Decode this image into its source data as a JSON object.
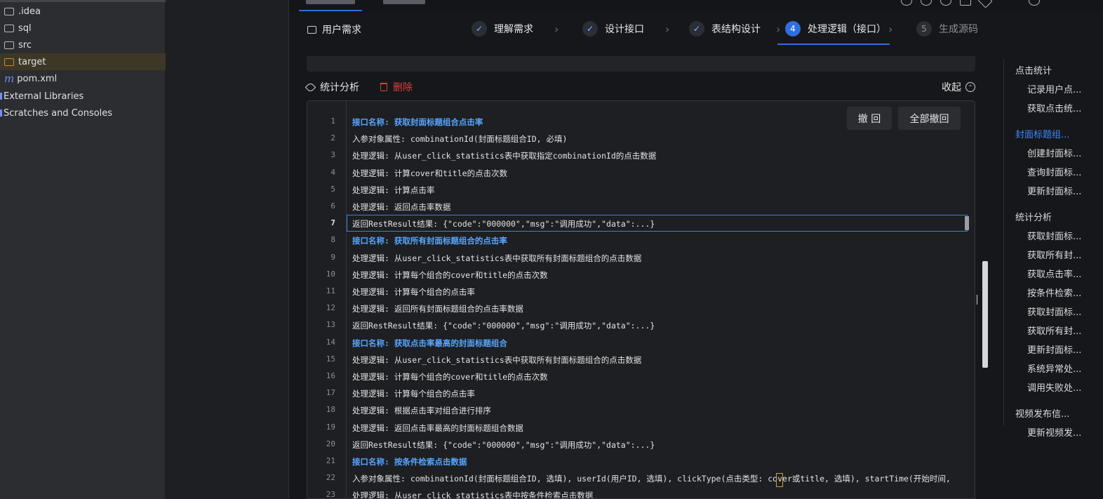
{
  "project_tree": [
    {
      "label": ".idea",
      "icon": "folder-icon"
    },
    {
      "label": "sql",
      "icon": "folder-icon"
    },
    {
      "label": "src",
      "icon": "folder-icon"
    },
    {
      "label": "target",
      "icon": "folder-orange-icon",
      "selected": true
    },
    {
      "label": "pom.xml",
      "icon": "maven-icon"
    },
    {
      "label": "External Libraries",
      "icon": "library-icon"
    },
    {
      "label": "Scratches and Consoles",
      "icon": "scratch-icon"
    }
  ],
  "header": {
    "requirement_label": "用户需求",
    "steps": [
      {
        "mark": "✓",
        "label": "理解需求",
        "state": "done"
      },
      {
        "mark": "✓",
        "label": "设计接口",
        "state": "done"
      },
      {
        "mark": "✓",
        "label": "表结构设计",
        "state": "done"
      },
      {
        "mark": "4",
        "label": "处理逻辑（接口）",
        "state": "current"
      },
      {
        "mark": "5",
        "label": "生成源码",
        "state": "todo"
      }
    ]
  },
  "section": {
    "title": "统计分析",
    "delete_label": "删除",
    "collapse_label": "收起"
  },
  "editor": {
    "undo_label": "撤 回",
    "undo_all_label": "全部撤回",
    "current_line": 7,
    "lines": [
      {
        "n": "1",
        "text": "接口名称: 获取封面标题组合点击率",
        "hl": true
      },
      {
        "n": "2",
        "text": "入参对象属性: combinationId(封面标题组合ID, 必填)"
      },
      {
        "n": "3",
        "text": "处理逻辑: 从user_click_statistics表中获取指定combinationId的点击数据"
      },
      {
        "n": "4",
        "text": "处理逻辑: 计算cover和title的点击次数"
      },
      {
        "n": "5",
        "text": "处理逻辑: 计算点击率"
      },
      {
        "n": "6",
        "text": "处理逻辑: 返回点击率数据"
      },
      {
        "n": "7",
        "text": "返回RestResult结果: {\"code\":\"000000\",\"msg\":\"调用成功\",\"data\":...}"
      },
      {
        "n": "8",
        "text": "接口名称: 获取所有封面标题组合的点击率",
        "hl": true
      },
      {
        "n": "9",
        "text": "处理逻辑: 从user_click_statistics表中获取所有封面标题组合的点击数据"
      },
      {
        "n": "10",
        "text": "处理逻辑: 计算每个组合的cover和title的点击次数"
      },
      {
        "n": "11",
        "text": "处理逻辑: 计算每个组合的点击率"
      },
      {
        "n": "12",
        "text": "处理逻辑: 返回所有封面标题组合的点击率数据"
      },
      {
        "n": "13",
        "text": "返回RestResult结果: {\"code\":\"000000\",\"msg\":\"调用成功\",\"data\":...}"
      },
      {
        "n": "14",
        "text": "接口名称: 获取点击率最高的封面标题组合",
        "hl": true
      },
      {
        "n": "15",
        "text": "处理逻辑: 从user_click_statistics表中获取所有封面标题组合的点击数据"
      },
      {
        "n": "16",
        "text": "处理逻辑: 计算每个组合的cover和title的点击次数"
      },
      {
        "n": "17",
        "text": "处理逻辑: 计算每个组合的点击率"
      },
      {
        "n": "18",
        "text": "处理逻辑: 根据点击率对组合进行排序"
      },
      {
        "n": "19",
        "text": "处理逻辑: 返回点击率最高的封面标题组合数据"
      },
      {
        "n": "20",
        "text": "返回RestResult结果: {\"code\":\"000000\",\"msg\":\"调用成功\",\"data\":...}"
      },
      {
        "n": "21",
        "text": "接口名称: 按条件检索点击数据",
        "hl": true
      },
      {
        "n": "22",
        "text": "入参对象属性: combinationId(封面标题组合ID, 选填), userId(用户ID, 选填), clickType(点击类型: cover或title, 选填), startTime(开始时间,"
      },
      {
        "n": "23",
        "text": "处理逻辑: 从user_click_statistics表中按条件检索点击数据"
      }
    ]
  },
  "outline": [
    {
      "label": "点击统计",
      "level": 1
    },
    {
      "label": "记录用户点...",
      "level": 2
    },
    {
      "label": "获取点击统...",
      "level": 2
    },
    {
      "label": "封面标题组...",
      "level": 1,
      "active": true
    },
    {
      "label": "创建封面标...",
      "level": 2
    },
    {
      "label": "查询封面标...",
      "level": 2
    },
    {
      "label": "更新封面标...",
      "level": 2
    },
    {
      "label": "统计分析",
      "level": 1
    },
    {
      "label": "获取封面标...",
      "level": 2
    },
    {
      "label": "获取所有封...",
      "level": 2
    },
    {
      "label": "获取点击率...",
      "level": 2
    },
    {
      "label": "按条件检索...",
      "level": 2
    },
    {
      "label": "获取封面标...",
      "level": 2
    },
    {
      "label": "获取所有封...",
      "level": 2
    },
    {
      "label": "更新封面标...",
      "level": 2
    },
    {
      "label": "系统异常处...",
      "level": 2
    },
    {
      "label": "调用失败处...",
      "level": 2
    },
    {
      "label": "视频发布信...",
      "level": 1
    },
    {
      "label": "更新视频发...",
      "level": 2
    }
  ],
  "colors": {
    "accent": "#2f6ee0",
    "highlight_text": "#56a5ff",
    "danger": "#d9403a"
  }
}
